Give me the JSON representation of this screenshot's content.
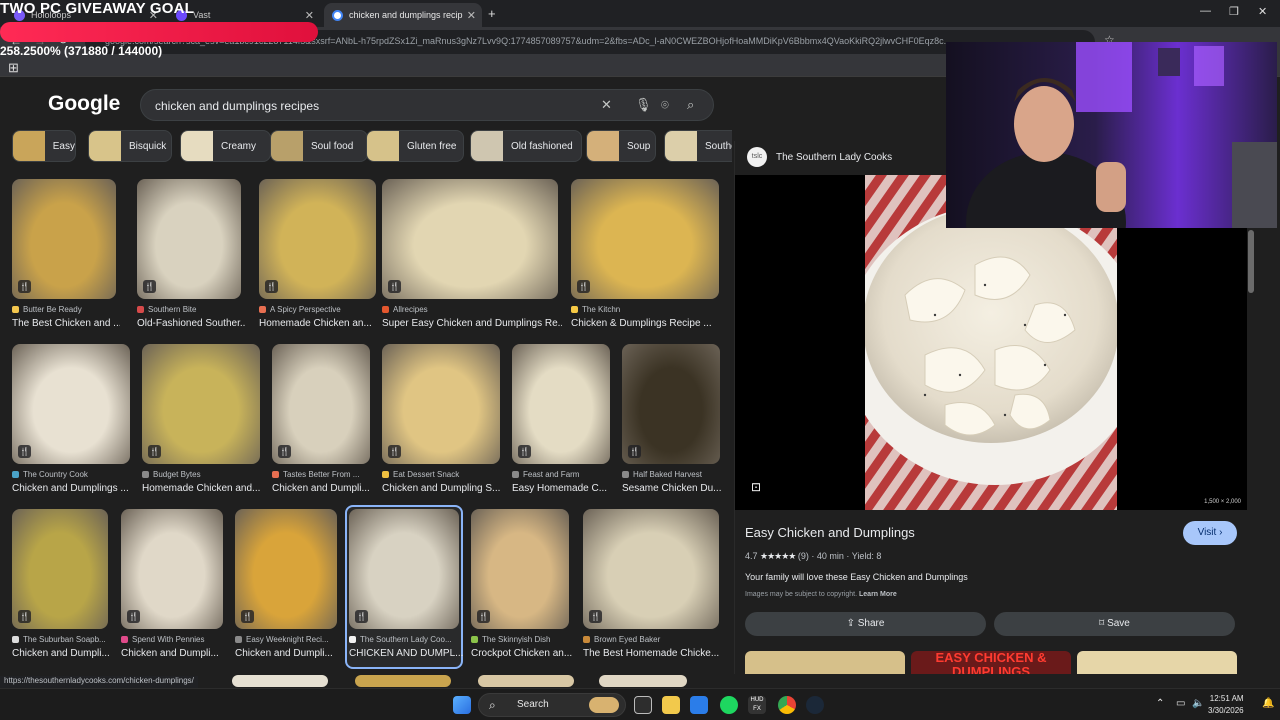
{
  "stream_overlay": {
    "goal_title": "TWO PC GIVEAWAY GOAL",
    "goal_readout": "258.2500% (371880 / 144000)",
    "goal_progress_percent": 258.25
  },
  "browser": {
    "tabs": [
      {
        "label": "Hololoops",
        "active": false
      },
      {
        "label": "Vast",
        "active": false
      },
      {
        "label": "chicken and dumplings recipes",
        "active": true
      }
    ],
    "new_tab_symbol": "+",
    "address": "google.com/search?sca_esv=ea1bc91c2287114f5&sxsrf=ANbL-h75rpdZSx1Zi_maRnus3gNz7Lvv9Q:1774857089757&udm=2&fbs=ADc_l-aN0CWEZBOHjofHoaMMDiKpV6Bbbmx4QVaoKkiRQ2jlwvCHF0Eqz8c...",
    "status_url": "https://thesouthernladycooks.com/chicken-dumplings/"
  },
  "search": {
    "logo": "Google",
    "query": "chicken and dumplings recipes",
    "chips": [
      {
        "label": "Easy",
        "color": "#c9a55a"
      },
      {
        "label": "Bisquick",
        "color": "#d8c48a"
      },
      {
        "label": "Creamy",
        "color": "#e6dcc0"
      },
      {
        "label": "Soul food",
        "color": "#b8a06a"
      },
      {
        "label": "Gluten free",
        "color": "#d6c28a"
      },
      {
        "label": "Old fashioned",
        "color": "#cfc6b0"
      },
      {
        "label": "Soup",
        "color": "#d4b07a"
      },
      {
        "label": "Southe",
        "color": "#dccfaa"
      }
    ]
  },
  "results": [
    {
      "source": "Butter Be Ready",
      "title": "The Best Chicken and ...",
      "color": "#c9a24a",
      "fav": "#f3c64e"
    },
    {
      "source": "Southern Bite",
      "title": "Old-Fashioned Souther...",
      "color": "#d9d2bf",
      "fav": "#d64a4a"
    },
    {
      "source": "A Spicy Perspective",
      "title": "Homemade Chicken an...",
      "color": "#d1b358",
      "fav": "#e76f51"
    },
    {
      "source": "Allrecipes",
      "title": "Super Easy Chicken and Dumplings Re...",
      "color": "#e2d6b2",
      "fav": "#e4572e"
    },
    {
      "source": "The Kitchn",
      "title": "Chicken & Dumplings Recipe ...",
      "color": "#dcb552",
      "fav": "#f6c945"
    },
    {
      "source": "The Country Cook",
      "title": "Chicken and Dumplings ...",
      "color": "#e8e1d2",
      "fav": "#4aa3c8"
    },
    {
      "source": "Budget Bytes",
      "title": "Homemade Chicken and...",
      "color": "#c8b35a",
      "fav": "#8a8a8a"
    },
    {
      "source": "Tastes Better From ...",
      "title": "Chicken and Dumpli...",
      "color": "#d8d0bc",
      "fav": "#e76f51"
    },
    {
      "source": "Eat Dessert Snack",
      "title": "Chicken and Dumpling S...",
      "color": "#e0c583",
      "fav": "#f0c040"
    },
    {
      "source": "Feast and Farm",
      "title": "Easy Homemade C...",
      "color": "#e4dcc4",
      "fav": "#8a8a8a"
    },
    {
      "source": "Half Baked Harvest",
      "title": "Sesame Chicken Du...",
      "color": "#3b3324",
      "fav": "#8a8a8a"
    },
    {
      "source": "The Suburban Soapb...",
      "title": "Chicken and Dumpli...",
      "color": "#b8a548",
      "fav": "#dcdcdc"
    },
    {
      "source": "Spend With Pennies",
      "title": "Chicken and Dumpli...",
      "color": "#e0d8c8",
      "fav": "#e04a8a"
    },
    {
      "source": "Easy Weeknight Reci...",
      "title": "Chicken and Dumpli...",
      "color": "#d9a43a",
      "fav": "#8a8a8a"
    },
    {
      "source": "The Southern Lady Coo...",
      "title": "CHICKEN AND DUMPL...",
      "color": "#d8d2c2",
      "fav": "#f1f1f1"
    },
    {
      "source": "The Skinnyish Dish",
      "title": "Crockpot Chicken an...",
      "color": "#d7b784",
      "fav": "#8bc34a"
    },
    {
      "source": "Brown Eyed Baker",
      "title": "The Best Homemade Chicke...",
      "color": "#d8cfb5",
      "fav": "#c98a3a"
    }
  ],
  "panel": {
    "source_name": "The Southern Lady Cooks",
    "source_fav_text": "tslc",
    "image_dims": "1,500 × 2,000",
    "title": "Easy Chicken and Dumplings",
    "visit_label": "Visit",
    "rating": "4.7",
    "stars": "★★★★★",
    "rating_count": "(9)",
    "time": "40 min",
    "yield": "Yield: 8",
    "description": "Your family will love these Easy Chicken and Dumplings",
    "copyright_note": "Images may be subject to copyright.",
    "learn_more": "Learn More",
    "share_label": "Share",
    "save_label": "Save",
    "strip_text": "EASY CHICKEN & DUMPLINGS"
  },
  "taskbar": {
    "search_label": "Search",
    "time": "12:51 AM",
    "date": "3/30/2026"
  }
}
